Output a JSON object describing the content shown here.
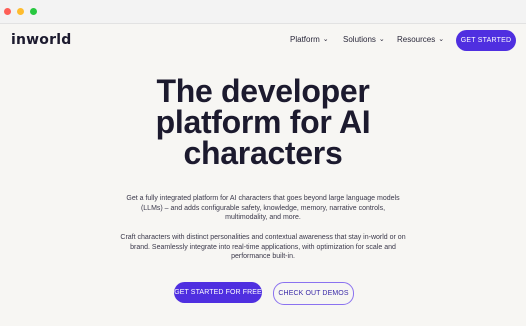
{
  "nav": {
    "logo": "inworld",
    "items": [
      {
        "label": "Platform"
      },
      {
        "label": "Solutions"
      },
      {
        "label": "Resources"
      }
    ],
    "cta": "GET STARTED"
  },
  "hero": {
    "title_lines": [
      "The developer",
      "platform for AI",
      "characters"
    ],
    "paragraph1": "Get a fully integrated platform for AI characters that goes beyond large language models (LLMs) – and adds configurable safety, knowledge, memory, narrative controls, multimodality, and more.",
    "paragraph2": "Craft characters with distinct personalities and contextual awareness that stay in-world or on brand. Seamlessly integrate into real-time applications, with optimization for scale and performance built-in.",
    "primary_button": "GET STARTED FOR FREE",
    "secondary_button": "CHECK OUT DEMOS"
  },
  "icons": {
    "chevron": "chevron-down-icon"
  },
  "colors": {
    "accent": "#4f2fe0",
    "outline": "#8b72f0",
    "background": "#f7f6f3",
    "text": "#1c1a2e"
  }
}
